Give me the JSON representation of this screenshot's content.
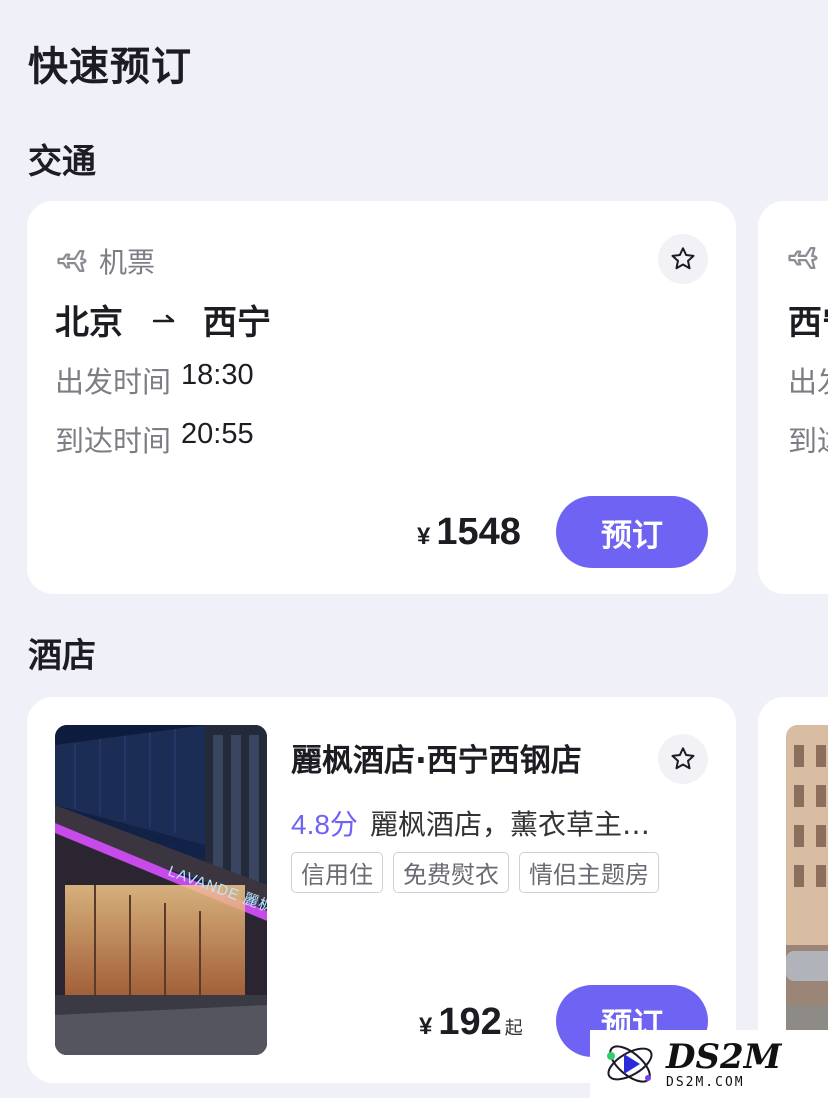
{
  "page_title": "快速预订",
  "sections": {
    "transport": "交通",
    "hotel": "酒店"
  },
  "flight": {
    "type_label": "机票",
    "from": "北京",
    "to": "西宁",
    "departure_label": "出发时间",
    "departure_time": "18:30",
    "arrival_label": "到达时间",
    "arrival_time": "20:55",
    "currency": "¥",
    "price": "1548",
    "book_label": "预订"
  },
  "flight_peek": {
    "route_start": "西宁",
    "line1": "出发",
    "line2": "到达"
  },
  "hotel": {
    "name": "麗枫酒店·西宁西钢店",
    "rating": "4.8分",
    "description": "麗枫酒店，薰衣草主…",
    "tags": [
      "信用住",
      "免费熨衣",
      "情侣主题房"
    ],
    "currency": "¥",
    "price": "192",
    "price_suffix": "起",
    "book_label": "预订",
    "image_sign": "LAVANDE 麗枫酒店"
  },
  "icons": {
    "plane": "plane-icon",
    "favorite": "star-outline-icon",
    "route_arrow": "arrow-right-icon"
  },
  "colors": {
    "accent": "#6e63f2",
    "background": "#eff0f8",
    "card": "#ffffff",
    "muted_text": "#7d7d85"
  },
  "watermark": {
    "big": "DS2M",
    "small": "DS2M.COM"
  }
}
